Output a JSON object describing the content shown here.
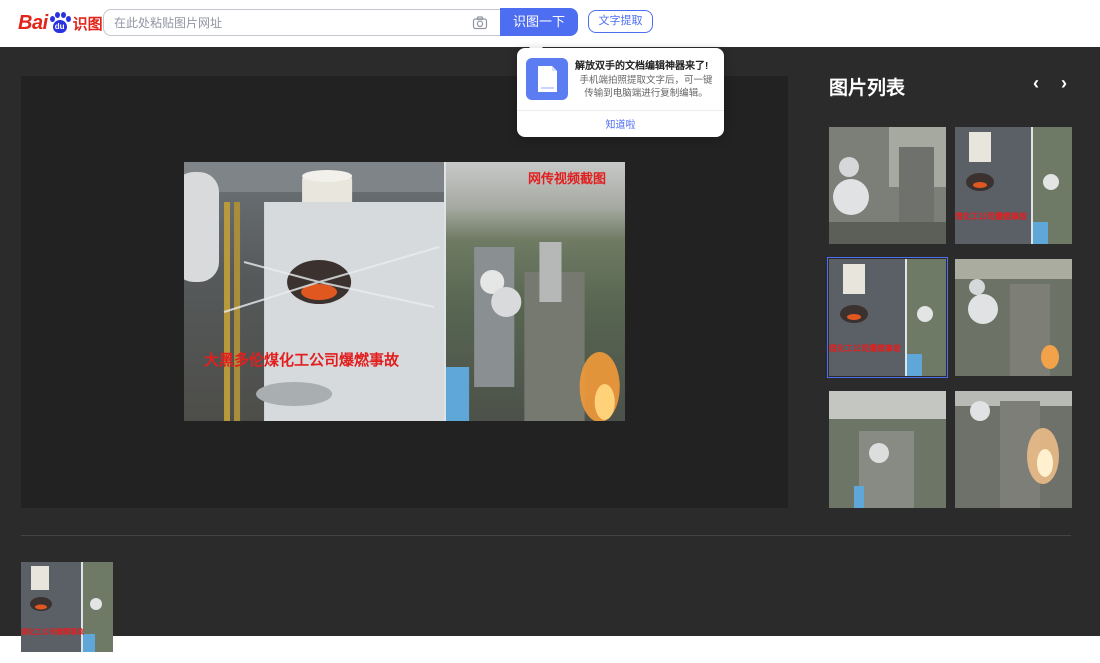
{
  "header": {
    "logo_text": "Bai",
    "logo_paw_text": "du",
    "logo_sub": "识图",
    "search_placeholder": "在此处粘贴图片网址",
    "search_button": "识图一下",
    "text_extract_button": "文字提取"
  },
  "tooltip": {
    "title": "解放双手的文档编辑神器来了!",
    "body": "手机端拍照提取文字后，可一键传输到电脑端进行复制编辑。",
    "link": "知道啦"
  },
  "preview": {
    "caption_left": "大黑多伦煤化工公司爆燃事故",
    "caption_right": "网传视频截图"
  },
  "image_list": {
    "title": "图片列表",
    "prev_icon": "‹",
    "next_icon": "›",
    "thumb_caption": "煤化工公司爆燃事故"
  },
  "colors": {
    "brand_red": "#e1251b",
    "brand_blue": "#4e6ef2",
    "dark_bg": "#2b2b2b"
  }
}
